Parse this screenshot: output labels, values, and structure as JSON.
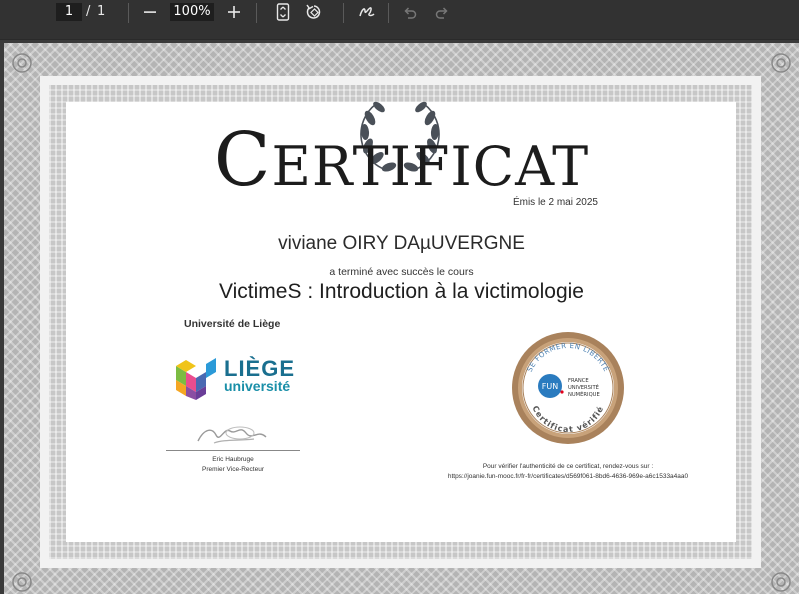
{
  "toolbar": {
    "current_page": "1",
    "separator": "/",
    "total_pages": "1",
    "zoom_out_icon": "minus-icon",
    "zoom": "100%",
    "zoom_in_icon": "plus-icon",
    "fit_page_icon": "fit-page-icon",
    "rotate_icon": "rotate-icon",
    "draw_icon": "draw-icon",
    "undo_icon": "undo-icon",
    "redo_icon": "redo-icon"
  },
  "certificate": {
    "title_initial": "C",
    "title_rest": "ERTIFICAT",
    "issued": "Émis le 2 mai 2025",
    "recipient": "viviane OIRY DAµUVERGNE",
    "completed_text": "a terminé avec succès le cours",
    "course": "VictimeS : Introduction à la victimologie",
    "organization": "Université de Liège",
    "logo_line1": "LIÈGE",
    "logo_line2": "université",
    "signer_name": "Eric Haubruge",
    "signer_role": "Premier Vice-Recteur",
    "verify_text": "Pour vérifier l'authenticité de ce certificat, rendez-vous sur :",
    "verify_url": "https://joanie.fun-mooc.fr/fr-fr/certificates/d569f061-8bd6-4636-969e-a6c1533a4aa0",
    "seal": {
      "ring_text_top": "SE FORMER EN LIBERTÉ",
      "ring_text_bottom": "Certificat vérifié",
      "badge": "FUN",
      "line1": "FRANCE",
      "line2": "UNIVERSITÉ",
      "line3": "NUMÉRIQUE"
    }
  },
  "colors": {
    "toolbar_bg": "#323232",
    "seal_outer": "#a9825c",
    "fun_blue": "#2a7bbf",
    "liege_blue": "#1a6f8f"
  }
}
